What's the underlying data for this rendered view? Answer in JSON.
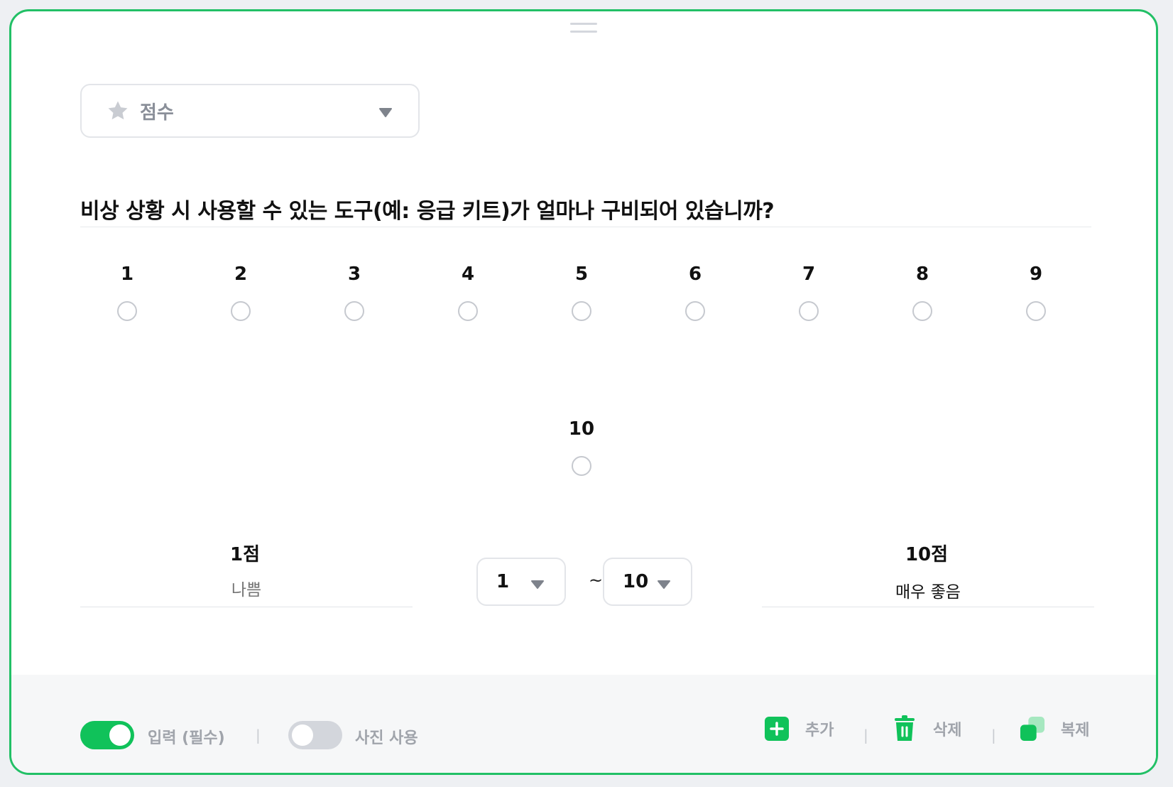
{
  "question_type": {
    "label": "점수",
    "icon": "star-icon"
  },
  "question": {
    "text": "비상 상황 시 사용할 수 있는 도구(예: 응급 키트)가 얼마나 구비되어 있습니까?"
  },
  "scale": {
    "options": [
      "1",
      "2",
      "3",
      "4",
      "5",
      "6",
      "7",
      "8",
      "9",
      "10"
    ],
    "min": {
      "score_label": "1점",
      "description": "",
      "description_placeholder": "나쁨"
    },
    "max": {
      "score_label": "10점",
      "description": "매우 좋음"
    },
    "range": {
      "from": "1",
      "separator": "~",
      "to": "10"
    }
  },
  "footer": {
    "required_toggle": {
      "label": "입력 (필수)",
      "on": true
    },
    "photo_toggle": {
      "label": "사진 사용",
      "on": false
    },
    "separator": "|",
    "actions": {
      "add": "추가",
      "delete": "삭제",
      "duplicate": "복제"
    }
  },
  "colors": {
    "accent": "#10c25a",
    "border": "#22c066",
    "muted": "#a0a4ab"
  }
}
